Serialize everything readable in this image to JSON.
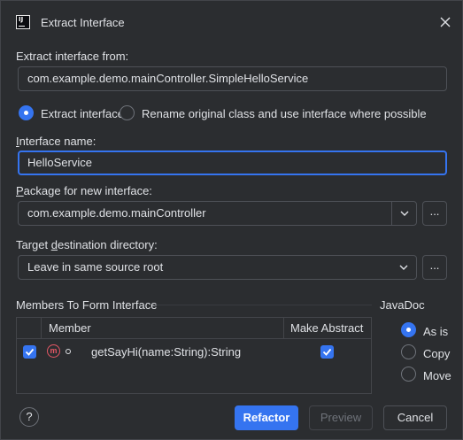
{
  "dialog": {
    "title": "Extract Interface",
    "app_icon_text": "IJ"
  },
  "extract_from": {
    "label": "Extract interface from:",
    "value": "com.example.demo.mainController.SimpleHelloService"
  },
  "mode": {
    "option_extract": "Extract interface",
    "option_rename": "Rename original class and use interface where possible",
    "selected": "Extract interface"
  },
  "interface_name": {
    "label_prefix": "I",
    "label_rest": "nterface name:",
    "value": "HelloService"
  },
  "package": {
    "label_prefix": "P",
    "label_rest": "ackage for new interface:",
    "value": "com.example.demo.mainController",
    "browse_label": "..."
  },
  "target_dir": {
    "label_before": "Target ",
    "label_prefix": "d",
    "label_rest": "estination directory:",
    "value": "Leave in same source root",
    "browse_label": "..."
  },
  "members": {
    "section_title": "Members To Form Interface",
    "columns": [
      "Member",
      "Make Abstract"
    ],
    "rows": [
      {
        "checked": true,
        "icon": "method-icon",
        "icon_letter": "m",
        "member": "getSayHi(name:String):String",
        "make_abstract": true
      }
    ]
  },
  "javadoc": {
    "title": "JavaDoc",
    "options": [
      "As is",
      "Copy",
      "Move"
    ],
    "selected": "As is"
  },
  "footer": {
    "help_label": "?",
    "refactor_label": "Refactor",
    "preview_label": "Preview",
    "cancel_label": "Cancel"
  },
  "colors": {
    "accent": "#3574f0",
    "background": "#2b2d30",
    "text": "#dfe1e5",
    "method_icon": "#e55765"
  }
}
